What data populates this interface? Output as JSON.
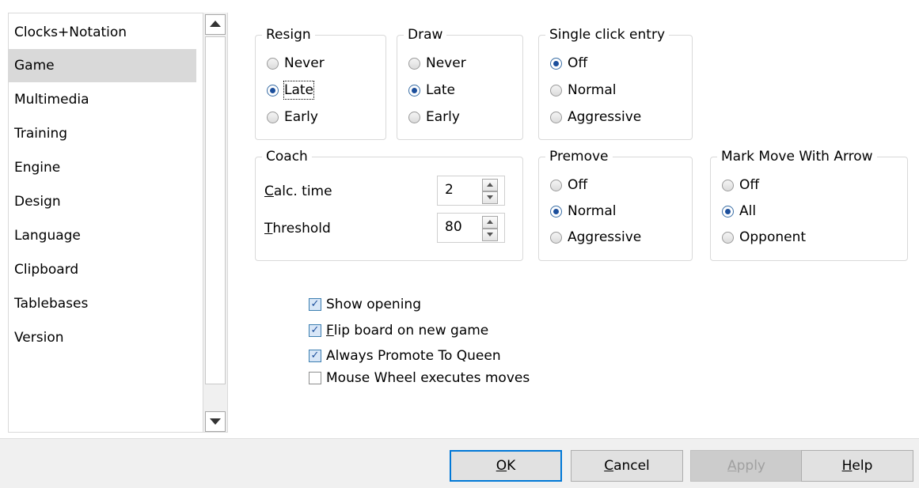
{
  "sidebar": {
    "items": [
      {
        "label": "Clocks+Notation",
        "selected": false
      },
      {
        "label": "Game",
        "selected": true
      },
      {
        "label": "Multimedia",
        "selected": false
      },
      {
        "label": "Training",
        "selected": false
      },
      {
        "label": "Engine",
        "selected": false
      },
      {
        "label": "Design",
        "selected": false
      },
      {
        "label": "Language",
        "selected": false
      },
      {
        "label": "Clipboard",
        "selected": false
      },
      {
        "label": "Tablebases",
        "selected": false
      },
      {
        "label": "Version",
        "selected": false
      }
    ]
  },
  "groups": {
    "resign": {
      "title": "Resign",
      "options": [
        "Never",
        "Late",
        "Early"
      ],
      "selected": "Late"
    },
    "draw": {
      "title": "Draw",
      "options": [
        "Never",
        "Late",
        "Early"
      ],
      "selected": "Late"
    },
    "single_click": {
      "title": "Single click entry",
      "options": [
        "Off",
        "Normal",
        "Aggressive"
      ],
      "selected": "Off"
    },
    "coach": {
      "title": "Coach",
      "calc_time": {
        "label_mnemonic": "C",
        "label_rest": "alc. time",
        "value": "2"
      },
      "threshold": {
        "label_mnemonic": "T",
        "label_rest": "hreshold",
        "value": "80"
      }
    },
    "premove": {
      "title": "Premove",
      "options": [
        "Off",
        "Normal",
        "Aggressive"
      ],
      "selected": "Normal"
    },
    "mark_move": {
      "title": "Mark Move With Arrow",
      "options": [
        "Off",
        "All",
        "Opponent"
      ],
      "selected": "All"
    }
  },
  "checks": [
    {
      "label_pre": "",
      "mnemonic": "",
      "label_post": "Show opening",
      "checked": true
    },
    {
      "label_pre": "",
      "mnemonic": "F",
      "label_post": "lip board on new game",
      "checked": true
    },
    {
      "label_pre": "",
      "mnemonic": "",
      "label_post": "Always Promote To Queen",
      "checked": true
    },
    {
      "label_pre": "",
      "mnemonic": "",
      "label_post": "Mouse Wheel executes moves",
      "checked": false
    }
  ],
  "buttons": {
    "ok": {
      "mnemonic": "O",
      "rest": "K"
    },
    "cancel": {
      "mnemonic": "C",
      "rest": "ancel"
    },
    "apply": {
      "mnemonic": "A",
      "rest": "pply"
    },
    "help": {
      "mnemonic": "H",
      "rest": "elp"
    }
  },
  "colors": {
    "selection": "#d9d9d9",
    "default_button_border": "#0078d7",
    "bottom_bar": "#f0f0f0"
  }
}
